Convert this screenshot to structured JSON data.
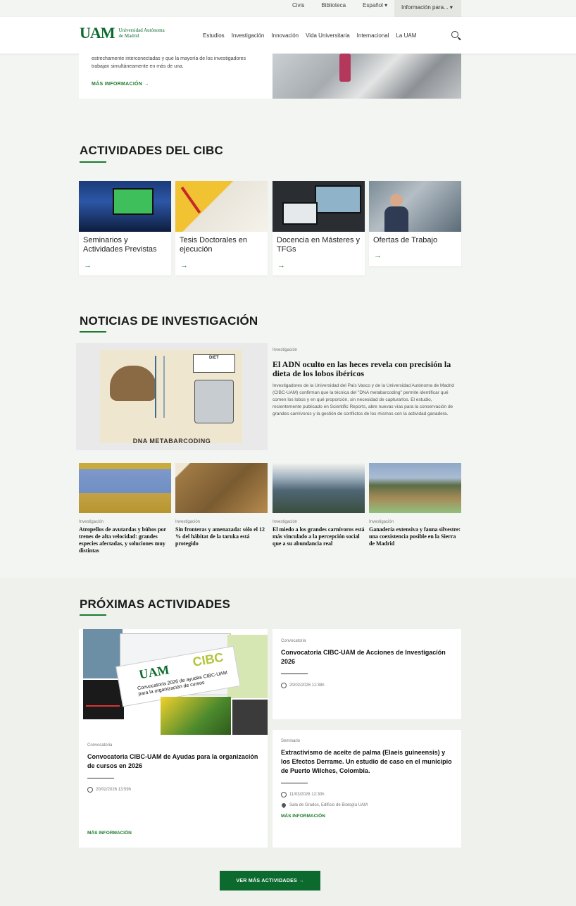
{
  "utility": {
    "items": [
      "Civis",
      "Biblioteca",
      "Español ▾"
    ],
    "info_label": "Información para... ▾"
  },
  "header": {
    "logo_mark": "UAM",
    "logo_name_1": "Universidad Autónoma",
    "logo_name_2": "de Madrid",
    "nav": [
      "Estudios",
      "Investigación",
      "Innovación",
      "Vida Universitaria",
      "Internacional",
      "La UAM"
    ]
  },
  "hero": {
    "text": "estrechamente interconectadas y que la mayoría de los investigadores trabajan simultáneamente en más de una.",
    "more": "MÁS INFORMACIÓN →"
  },
  "activities": {
    "title": "ACTIVIDADES DEL CIBC",
    "cards": [
      {
        "label": "Seminarios y Actividades Previstas",
        "arrow": "→"
      },
      {
        "label": "Tesis Doctorales en ejecución",
        "arrow": "→"
      },
      {
        "label": "Docencia en Másteres y TFGs",
        "arrow": "→"
      },
      {
        "label": "Ofertas de Trabajo",
        "arrow": "→"
      }
    ]
  },
  "news": {
    "title": "NOTICIAS DE INVESTIGACIÓN",
    "feature": {
      "category": "Investigación",
      "headline": "El ADN oculto en las heces revela con precisión la dieta de los lobos ibéricos",
      "summary": "Investigadores de la Universidad del País Vasco y de la Universidad Autónoma de Madrid (CIBC-UAM) confirman que la técnica del \"DNA metabarcoding\" permite identificar qué comen los lobos y en qué proporción, sin necesidad de capturarlos. El estudio, recientemente publicado en Scientific Reports, abre nuevas vías para la conservación de grandes carnívoros y la gestión de conflictos de los mismos con la actividad ganadera.",
      "image_caption": "DNA METABARCODING",
      "image_diet": "DIET"
    },
    "items": [
      {
        "category": "Investigación",
        "headline": "Atropellos de avutardas y búhos por trenes de alta velocidad: grandes especies afectadas, y soluciones muy distintas"
      },
      {
        "category": "Investigación",
        "headline": "Sin fronteras y amenazada: sólo el 12 % del hábitat de la taruka está protegido"
      },
      {
        "category": "Investigación",
        "headline": "El miedo a los grandes carnívoros está más vinculado a la percepción social que a su abundancia real"
      },
      {
        "category": "Investigación",
        "headline": "Ganadería extensiva y fauna silvestre: una coexistencia posible en la Sierra de Madrid"
      }
    ]
  },
  "upcoming": {
    "title": "PRÓXIMAS ACTIVIDADES",
    "big": {
      "category": "Convocatoria",
      "title": "Convocatoria CIBC-UAM de Ayudas para la organización de cursos en 2026",
      "date": "20/02/2026 13:59h",
      "more": "MÁS INFORMACIÓN",
      "collage_text_1": "UAM",
      "collage_text_2": "CIBC",
      "collage_text_3": "Convocatoria 2026 de ayudas CIBC-UAM para la organización de cursos"
    },
    "cards": [
      {
        "category": "Convocatoria",
        "title": "Convocatoria CIBC-UAM de Acciones de Investigación 2026",
        "date": "20/02/2026 11:38h"
      },
      {
        "category": "Seminario",
        "title": "Extractivismo de aceite de palma (Elaeis guineensis) y los Efectos Derrame. Un estudio de caso en el municipio de Puerto Wilches, Colombia.",
        "date": "11/03/2026 12:30h",
        "place": "Sala de Grados, Edificio de Biología UAM",
        "more": "MÁS INFORMACIÓN"
      }
    ],
    "button": "VER MÁS ACTIVIDADES →"
  },
  "colors": {
    "brand_green": "#0c6a2e",
    "accent_green": "#1d7a2e"
  }
}
